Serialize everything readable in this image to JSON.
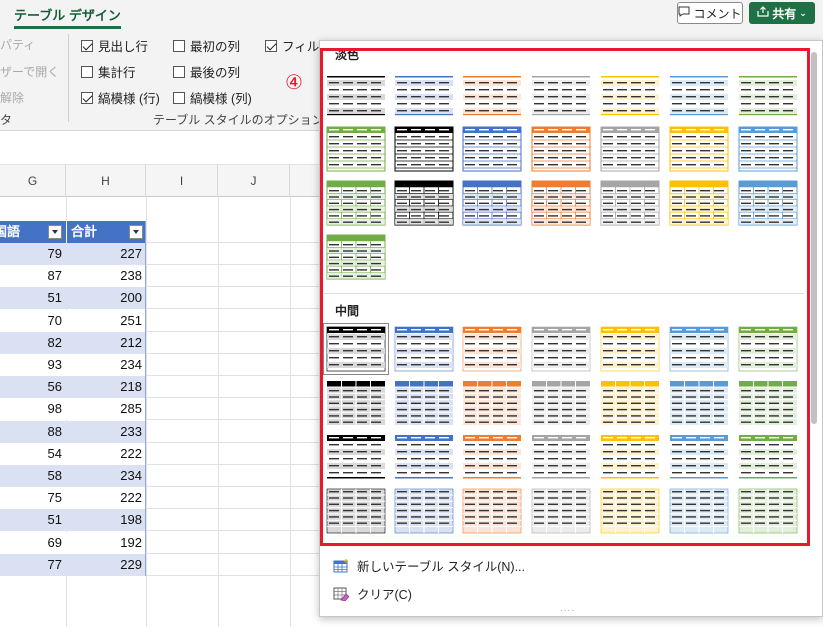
{
  "ribbon": {
    "tab": "テーブル デザイン",
    "comment": "コメント",
    "share": "共有",
    "left_faded": [
      "パティ",
      "ザーで開く",
      "解除"
    ],
    "left_group_label": "タ",
    "options": {
      "header_row": "見出し行",
      "total_row": "集計行",
      "banded_rows": "縞模様 (行)",
      "first_column": "最初の列",
      "last_column": "最後の列",
      "banded_columns": "縞模様 (列)",
      "filter_button": "フィルター ボ"
    },
    "options_group_label": "テーブル スタイルのオプション"
  },
  "sheet": {
    "columns": [
      "G",
      "H",
      "I",
      "J"
    ],
    "table_headers": [
      "国語",
      "合計"
    ],
    "rows": [
      [
        "79",
        "227"
      ],
      [
        "87",
        "238"
      ],
      [
        "51",
        "200"
      ],
      [
        "70",
        "251"
      ],
      [
        "82",
        "212"
      ],
      [
        "93",
        "234"
      ],
      [
        "56",
        "218"
      ],
      [
        "98",
        "285"
      ],
      [
        "88",
        "233"
      ],
      [
        "54",
        "222"
      ],
      [
        "58",
        "234"
      ],
      [
        "75",
        "222"
      ],
      [
        "51",
        "198"
      ],
      [
        "69",
        "192"
      ],
      [
        "77",
        "229"
      ]
    ]
  },
  "gallery": {
    "section_light": "淡色",
    "section_medium": "中間",
    "annotation": "④",
    "new_style": "新しいテーブル スタイル(N)...",
    "clear": "クリア(C)",
    "grip": "....",
    "accent_colors": [
      "#000000",
      "#4472c4",
      "#ed7d31",
      "#a5a5a5",
      "#ffc000",
      "#5b9bd5",
      "#70ad47"
    ]
  },
  "colors": {
    "accent": "#1e7145",
    "table_header": "#4472c4",
    "band": "#d9e1f2",
    "annotation": "#e8192c"
  }
}
